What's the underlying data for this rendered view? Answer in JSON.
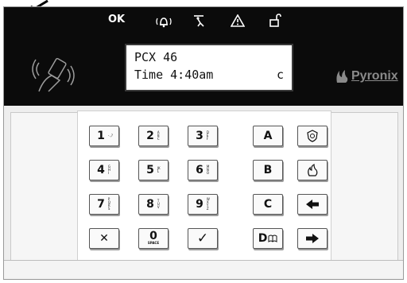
{
  "display": {
    "line1": "PCX 46",
    "line2_text": "Time 4:40am",
    "line2_flag": "c"
  },
  "status_bar": {
    "ok_label": "OK",
    "icons": [
      "bell-icon",
      "walking-person-icon",
      "warning-triangle-icon",
      "unlocked-padlock-icon"
    ]
  },
  "brand": {
    "name": "Pyronix"
  },
  "keypad": {
    "digits": [
      {
        "main": "1",
        "sub": "-.,?"
      },
      {
        "main": "2",
        "sub": "ABC"
      },
      {
        "main": "3",
        "sub": "DEF"
      },
      {
        "main": "4",
        "sub": "GHI"
      },
      {
        "main": "5",
        "sub": "JKL"
      },
      {
        "main": "6",
        "sub": "MNO"
      },
      {
        "main": "7",
        "sub": "PQRS"
      },
      {
        "main": "8",
        "sub": "TUV"
      },
      {
        "main": "9",
        "sub": "WXYZ"
      },
      {
        "main": "0",
        "sub": "SPACE"
      }
    ],
    "letters": [
      "A",
      "B",
      "C",
      "D"
    ],
    "cancel_symbol": "✕",
    "confirm_symbol": "✓",
    "function_icons": [
      "police-icon",
      "fire-icon",
      "left-arrow-icon",
      "right-arrow-icon",
      "book-icon"
    ],
    "accent": "#0b0b0b"
  }
}
